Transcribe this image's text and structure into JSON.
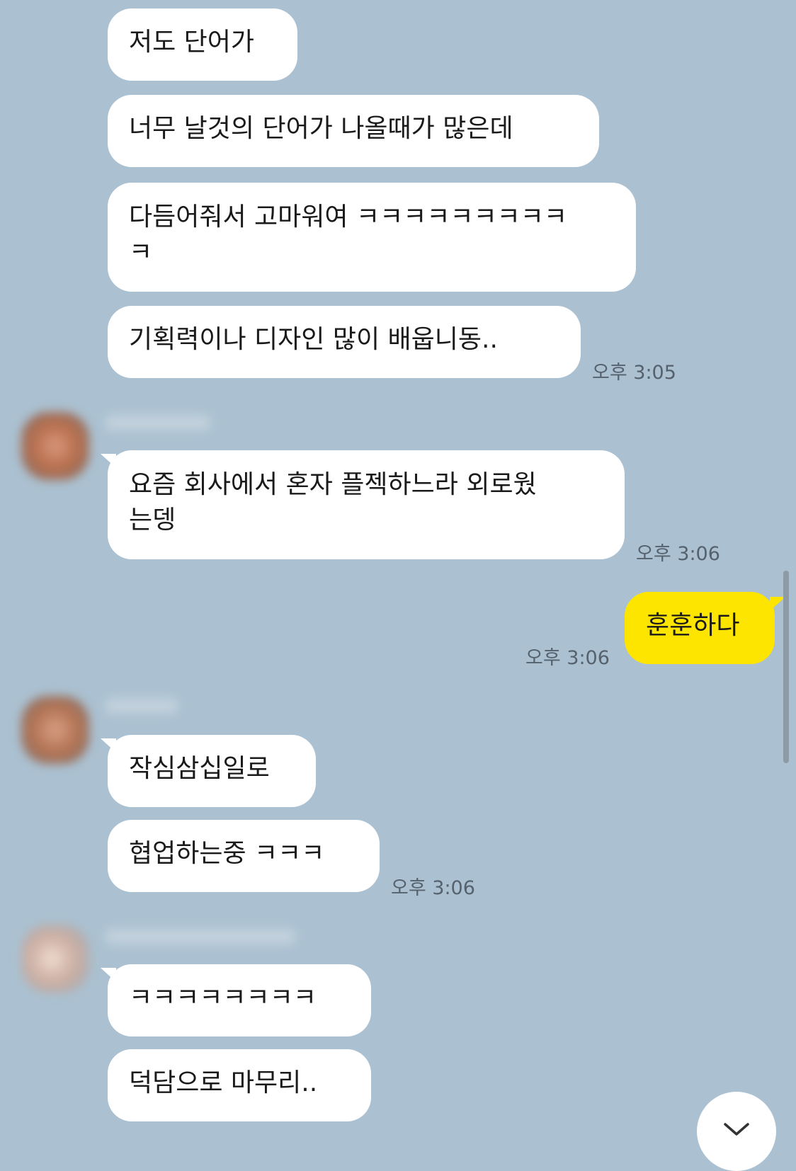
{
  "chat": {
    "groups": [
      {
        "messages": [
          "저도 단어가",
          "너무 날것의 단어가 나올때가 많은데",
          "다듬어줘서 고마워여 ㅋㅋㅋㅋㅋㅋㅋㅋㅋ\nㅋ",
          "기획력이나 디자인 많이 배웁니동.."
        ],
        "time": "오후 3:05"
      },
      {
        "messages": [
          "요즘 회사에서 혼자 플젝하느라 외로웠\n는뎅"
        ],
        "time": "오후 3:06"
      },
      {
        "messages": [
          "훈훈하다"
        ],
        "time": "오후 3:06"
      },
      {
        "messages": [
          "작심삼십일로",
          "협업하는중 ㅋㅋㅋ"
        ],
        "time": "오후 3:06"
      },
      {
        "messages": [
          "ㅋㅋㅋㅋㅋㅋㅋㅋ",
          "덕담으로 마무리.."
        ]
      }
    ]
  },
  "colors": {
    "background": "#abc1d1",
    "other_bubble": "#ffffff",
    "my_bubble": "#fee500",
    "timestamp_text": "#55626d"
  },
  "icons": {
    "scroll_down": "chevron-down-icon"
  }
}
